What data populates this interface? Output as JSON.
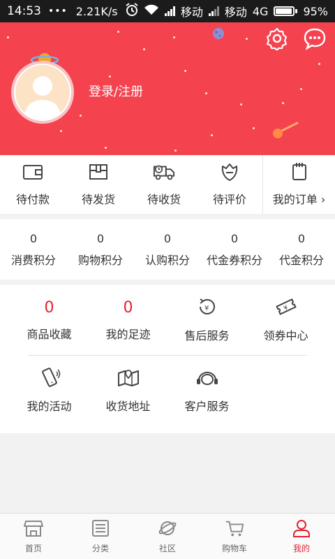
{
  "status_bar": {
    "time": "14:53",
    "dots": "•••",
    "speed": "2.21K/s",
    "carrier1": "移动",
    "carrier2": "移动",
    "network": "4G",
    "battery": "95%"
  },
  "header": {
    "login_text": "登录/注册",
    "bg_color": "#f5424f"
  },
  "orders": {
    "items": [
      {
        "label": "待付款",
        "icon": "wallet-icon"
      },
      {
        "label": "待发货",
        "icon": "box-icon"
      },
      {
        "label": "待收货",
        "icon": "truck-icon"
      },
      {
        "label": "待评价",
        "icon": "review-icon"
      }
    ],
    "my_orders": "我的订单",
    "my_orders_icon": "notepad-icon"
  },
  "points": [
    {
      "value": "0",
      "label": "消费积分"
    },
    {
      "value": "0",
      "label": "购物积分"
    },
    {
      "value": "0",
      "label": "认购积分"
    },
    {
      "value": "0",
      "label": "代金券积分"
    },
    {
      "value": "0",
      "label": "代金积分"
    }
  ],
  "services": {
    "row1": [
      {
        "count": "0",
        "label": "商品收藏"
      },
      {
        "count": "0",
        "label": "我的足迹"
      },
      {
        "label": "售后服务",
        "icon": "aftersale-icon"
      },
      {
        "label": "领券中心",
        "icon": "coupon-icon"
      }
    ],
    "row2": [
      {
        "label": "我的活动",
        "icon": "phone-icon"
      },
      {
        "label": "收货地址",
        "icon": "map-icon"
      },
      {
        "label": "客户服务",
        "icon": "headset-icon"
      }
    ]
  },
  "bottom_nav": [
    {
      "label": "首页",
      "icon": "shop-icon"
    },
    {
      "label": "分类",
      "icon": "list-icon"
    },
    {
      "label": "社区",
      "icon": "planet-icon"
    },
    {
      "label": "购物车",
      "icon": "cart-icon"
    },
    {
      "label": "我的",
      "icon": "user-icon",
      "active": true
    }
  ],
  "colors": {
    "accent": "#e4212f",
    "header": "#f5424f"
  }
}
